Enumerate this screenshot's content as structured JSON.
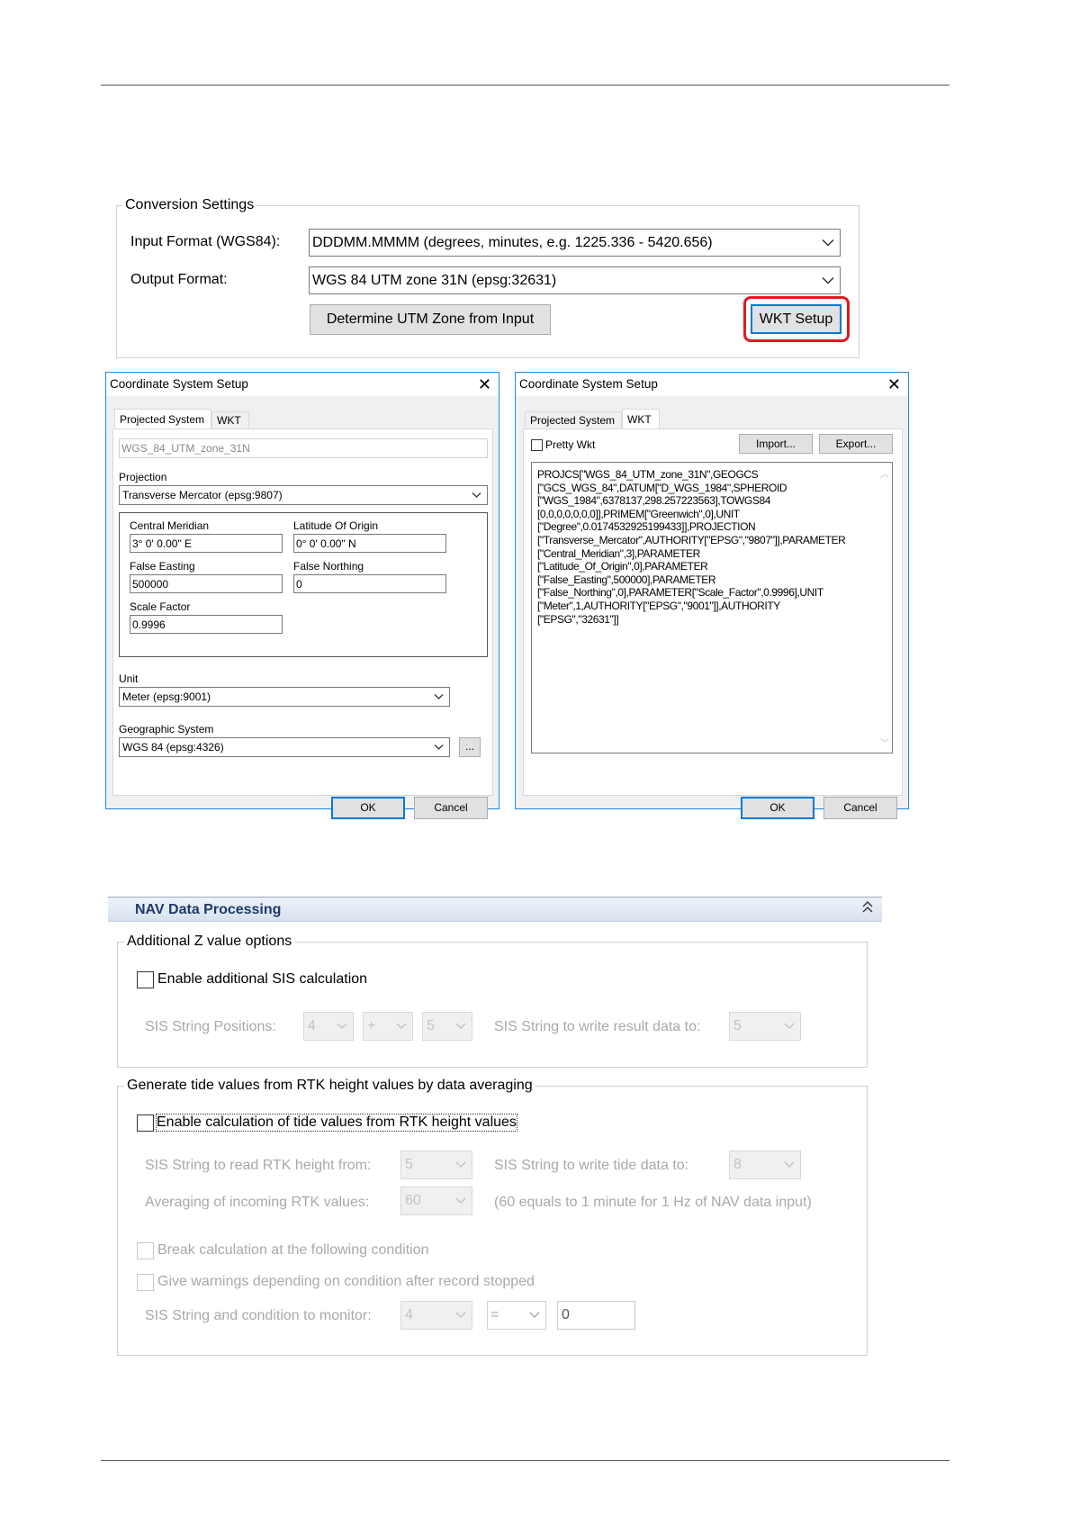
{
  "conversion": {
    "legend": "Conversion Settings",
    "input_label": "Input Format (WGS84):",
    "input_value": "DDDMM.MMMM  (degrees, minutes, e.g. 1225.336 - 5420.656)",
    "output_label": "Output Format:",
    "output_value": "WGS 84 UTM zone 31N (epsg:32631)",
    "determine_button": "Determine UTM Zone from Input",
    "wkt_button": "WKT Setup",
    "highlight_color": "#e0191e"
  },
  "dialog_left": {
    "title": "Coordinate System Setup",
    "tabs": [
      "Projected System",
      "WKT"
    ],
    "name_value": "WGS_84_UTM_zone_31N",
    "projection_label": "Projection",
    "projection_value": "Transverse Mercator (epsg:9807)",
    "params": {
      "central_meridian_label": "Central Meridian",
      "central_meridian_value": "3° 0' 0.00\" E",
      "latitude_origin_label": "Latitude Of Origin",
      "latitude_origin_value": "0° 0' 0.00\" N",
      "false_easting_label": "False Easting",
      "false_easting_value": "500000",
      "false_northing_label": "False Northing",
      "false_northing_value": "0",
      "scale_factor_label": "Scale Factor",
      "scale_factor_value": "0.9996"
    },
    "unit_label": "Unit",
    "unit_value": "Meter (epsg:9001)",
    "geo_label": "Geographic System",
    "geo_value": "WGS 84 (epsg:4326)",
    "ellipsis_button": "...",
    "ok": "OK",
    "cancel": "Cancel"
  },
  "dialog_right": {
    "title": "Coordinate System Setup",
    "tabs": [
      "Projected System",
      "WKT"
    ],
    "pretty_label": "Pretty Wkt",
    "import_button": "Import...",
    "export_button": "Export...",
    "wkt_lines": [
      "PROJCS[\"WGS_84_UTM_zone_31N\",GEOGCS",
      "[\"GCS_WGS_84\",DATUM[\"D_WGS_1984\",SPHEROID",
      "[\"WGS_1984\",6378137,298.257223563],TOWGS84",
      "[0,0,0,0,0,0,0]],PRIMEM[\"Greenwich\",0],UNIT",
      "[\"Degree\",0.0174532925199433]],PROJECTION",
      "[\"Transverse_Mercator\",AUTHORITY[\"EPSG\",\"9807\"]],PARAMETER",
      "[\"Central_Meridian\",3],PARAMETER",
      "[\"Latitude_Of_Origin\",0],PARAMETER",
      "[\"False_Easting\",500000],PARAMETER",
      "[\"False_Northing\",0],PARAMETER[\"Scale_Factor\",0.9996],UNIT",
      "[\"Meter\",1,AUTHORITY[\"EPSG\",\"9001\"]],AUTHORITY",
      "[\"EPSG\",\"32631\"]]"
    ],
    "ok": "OK",
    "cancel": "Cancel"
  },
  "nav": {
    "header": "NAV Data Processing",
    "z_group": {
      "legend": "Additional Z value options",
      "enable_sis": "Enable additional SIS calculation",
      "positions_label": "SIS String Positions:",
      "pos1": "4",
      "pos2": "+",
      "pos3": "5",
      "write_label": "SIS String to write result data to:",
      "write_value": "5"
    },
    "tide_group": {
      "legend": "Generate tide values from RTK height values by data averaging",
      "enable_tide": "Enable calculation of tide values from RTK height values",
      "read_label": "SIS String to read RTK height from:",
      "read_value": "5",
      "tide_write_label": "SIS String to write tide data to:",
      "tide_write_value": "8",
      "avg_label": "Averaging of incoming RTK values:",
      "avg_value": "60",
      "avg_note": "(60 equals to 1 minute for 1 Hz of NAV data input)",
      "break_label": "Break calculation at the following condition",
      "warn_label": "Give warnings depending on condition after record stopped",
      "monitor_label": "SIS String and condition to monitor:",
      "monitor_value": "4",
      "operator_value": "=",
      "threshold_value": "0"
    }
  }
}
